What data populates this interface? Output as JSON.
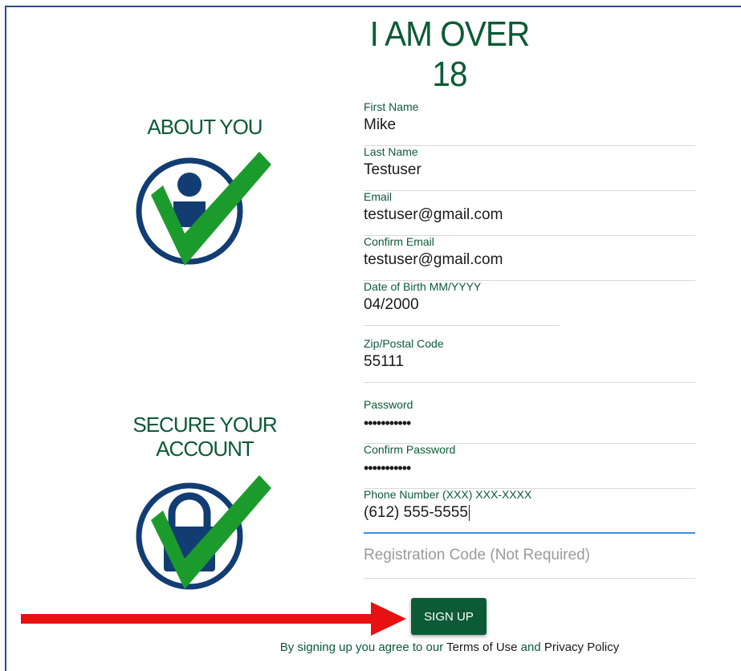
{
  "page": {
    "title": "I AM OVER 18"
  },
  "sections": {
    "about": "ABOUT YOU",
    "secure_line1": "SECURE YOUR",
    "secure_line2": "ACCOUNT"
  },
  "form": {
    "first_name": {
      "label": "First Name",
      "value": "Mike"
    },
    "last_name": {
      "label": "Last Name",
      "value": "Testuser"
    },
    "email": {
      "label": "Email",
      "value": "testuser@gmail.com"
    },
    "confirm_email": {
      "label": "Confirm Email",
      "value": "testuser@gmail.com"
    },
    "dob": {
      "label": "Date of Birth MM/YYYY",
      "value": "04/2000"
    },
    "zip": {
      "label": "Zip/Postal Code",
      "value": "55111"
    },
    "password": {
      "label": "Password",
      "value": "•••••••••••"
    },
    "confirm_password": {
      "label": "Confirm Password",
      "value": "•••••••••••"
    },
    "phone": {
      "label": "Phone Number (XXX) XXX-XXXX",
      "value": "(612) 555-5555"
    },
    "registration_code": {
      "placeholder": "Registration Code (Not Required)"
    }
  },
  "signup": {
    "label": "SIGN UP"
  },
  "terms": {
    "prefix": "By signing up you agree to our",
    "terms_link": "Terms of Use",
    "and": "and",
    "privacy_link": "Privacy Policy"
  },
  "colors": {
    "brand_green": "#0c5a36",
    "icon_navy": "#123d73",
    "check_green": "#1c9b2d",
    "arrow_red": "#e81010",
    "focus_blue": "#3a8de0"
  },
  "icons": {
    "about": "person-check-icon",
    "secure": "lock-check-icon",
    "arrow": "red-arrow-pointer"
  }
}
